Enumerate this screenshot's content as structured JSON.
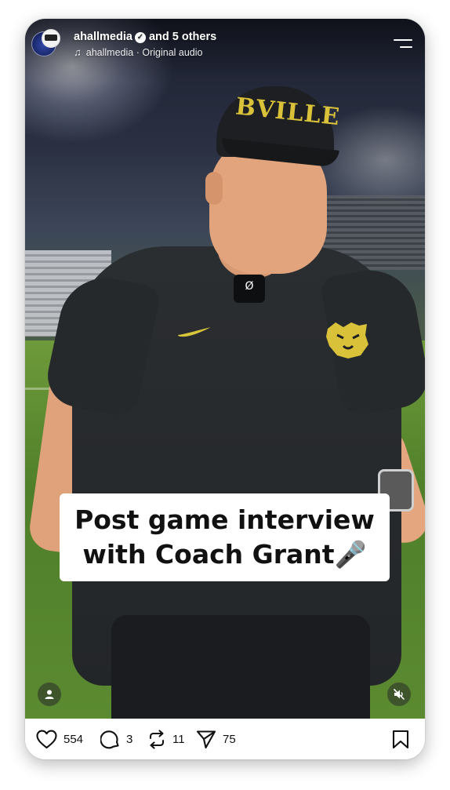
{
  "post": {
    "author": "ahallmedia",
    "coauthors": "and 5 others",
    "audio_author": "ahallmedia",
    "audio_separator": "·",
    "audio_label": "Original audio",
    "cap_text": "BVILLE",
    "mic_label": "Ø"
  },
  "caption": {
    "line1": "Post game interview",
    "line2": "with Coach Grant🎤"
  },
  "actions": {
    "likes": "554",
    "comments": "3",
    "reposts": "11",
    "shares": "75"
  },
  "icons": {
    "verified": "verified-badge-icon",
    "music": "music-note-icon",
    "menu": "menu-icon",
    "tag_people": "tag-people-icon",
    "mute": "muted-speaker-icon",
    "like": "heart-icon",
    "comment": "comment-bubble-icon",
    "repost": "repost-icon",
    "share": "send-icon",
    "save": "bookmark-icon"
  }
}
